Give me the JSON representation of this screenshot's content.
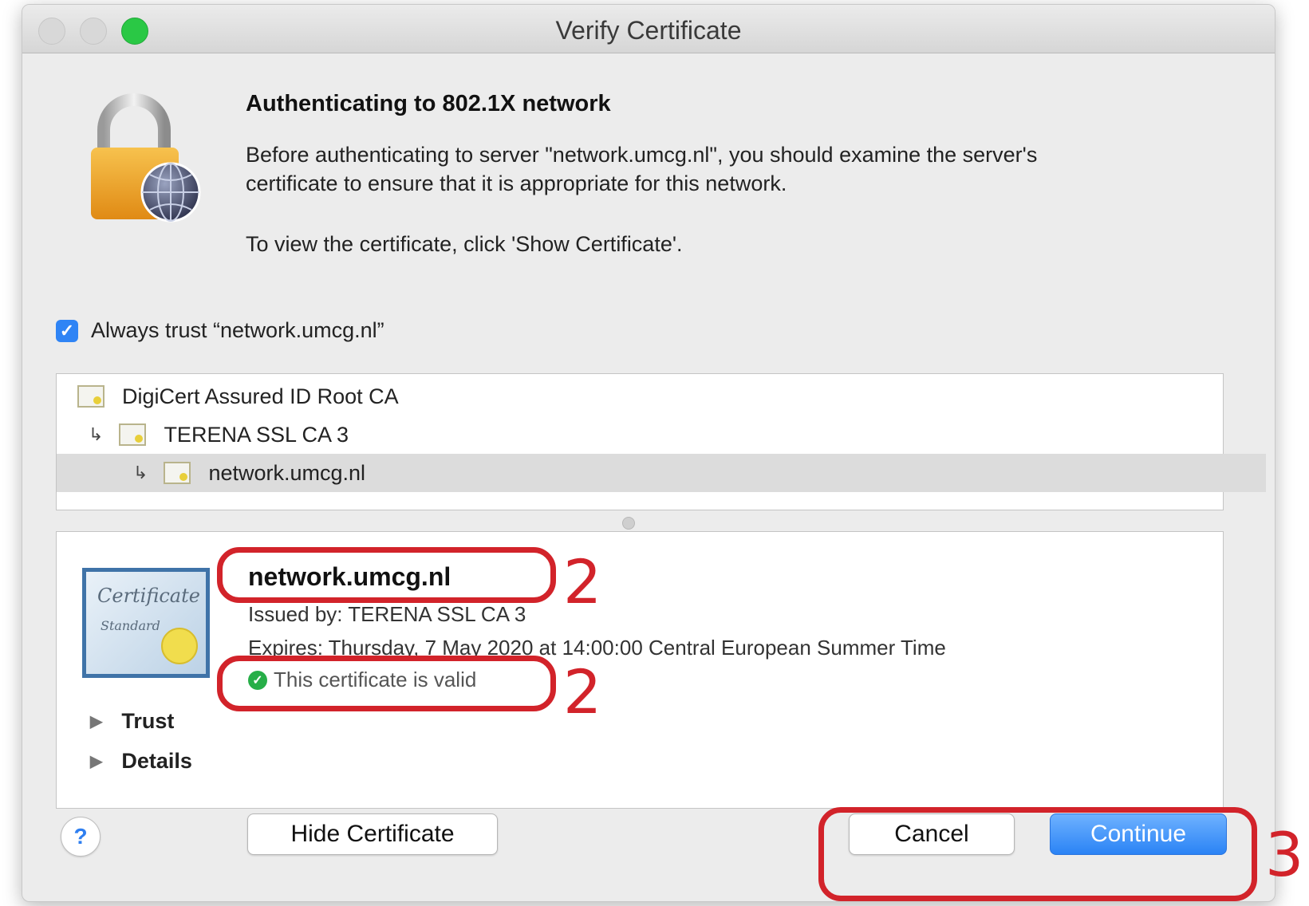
{
  "window": {
    "title": "Verify Certificate"
  },
  "dialog": {
    "heading": "Authenticating to 802.1X network",
    "message_line1": "Before authenticating to server \"network.umcg.nl\", you should examine the server's",
    "message_line2": "certificate to ensure that it is appropriate for this network.",
    "message2": "To view the certificate, click 'Show Certificate'.",
    "always_trust_label": "Always trust “network.umcg.nl”",
    "always_trust_checked": true
  },
  "cert_chain": [
    {
      "label": "DigiCert Assured ID Root CA",
      "level": 0,
      "selected": false
    },
    {
      "label": "TERENA SSL CA 3",
      "level": 1,
      "selected": false
    },
    {
      "label": "network.umcg.nl",
      "level": 2,
      "selected": true
    }
  ],
  "cert_detail": {
    "badge_line1": "Certificate",
    "badge_line2": "Standard",
    "name": "network.umcg.nl",
    "issued_by": "Issued by: TERENA SSL CA 3",
    "expires": "Expires: Thursday, 7 May 2020 at 14:00:00 Central European Summer Time",
    "status": "This certificate is valid",
    "trust_label": "Trust",
    "details_label": "Details"
  },
  "buttons": {
    "help": "?",
    "hide_certificate": "Hide Certificate",
    "cancel": "Cancel",
    "continue": "Continue"
  },
  "annotations": {
    "name_marker": "2",
    "valid_marker": "2",
    "buttons_marker": "3",
    "color": "#d2232a"
  },
  "colors": {
    "accent": "#2f84f5",
    "valid": "#27ae48",
    "zoom_button": "#2ac845"
  }
}
